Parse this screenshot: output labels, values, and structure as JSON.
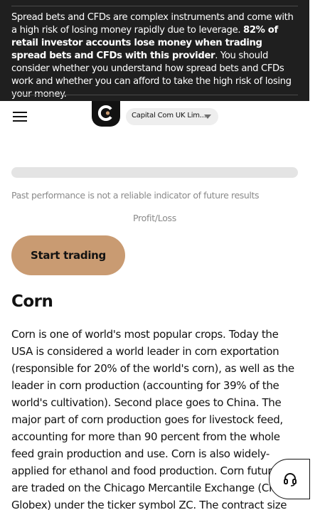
{
  "risk_warning": {
    "part1": "Spread bets and CFDs are complex instruments and come with a high risk of losing money rapidly due to leverage. ",
    "bold": "82% of retail investor accounts lose money when trading spread bets and CFDs with this provider",
    "part2": ". You should consider whether you understand how spread bets and CFDs work and whether you can afford to take the high risk of losing your money."
  },
  "header": {
    "entity_selector": {
      "value": "Capital Com UK Lim..."
    }
  },
  "performance": {
    "bar_fill_fraction": 0,
    "disclaimer": "Past performance is not a reliable indicator of future results",
    "profit_loss_label": "Profit/Loss"
  },
  "cta": {
    "label": "Start trading"
  },
  "article": {
    "title": "Corn",
    "body": "Corn is one of world's most popular crops. Today the USA is considered a world leader in corn exportation (responsible for 20% of the world's corn), as well as the leader in corn production (accounting for 39% of the world's cultivation). Second place goes to China. The major part of corn production goes for livestock feed, accounting for more than 90 percent from the whole feed grain production and use. Corn is also widely-applied for ethanol and food production. Corn futures are traded on the Chicago Mercantile Exchange (CME Globex) under the ticker symbol ZC. The contract size"
  },
  "colors": {
    "banner_bg": "#1f1f1f",
    "accent": "#c99b72",
    "track": "#e4e4e4"
  },
  "icons": {
    "menu": "hamburger-menu-icon",
    "logo": "capital-com-logo",
    "dropdown": "caret-down-icon",
    "support": "headset-icon"
  }
}
